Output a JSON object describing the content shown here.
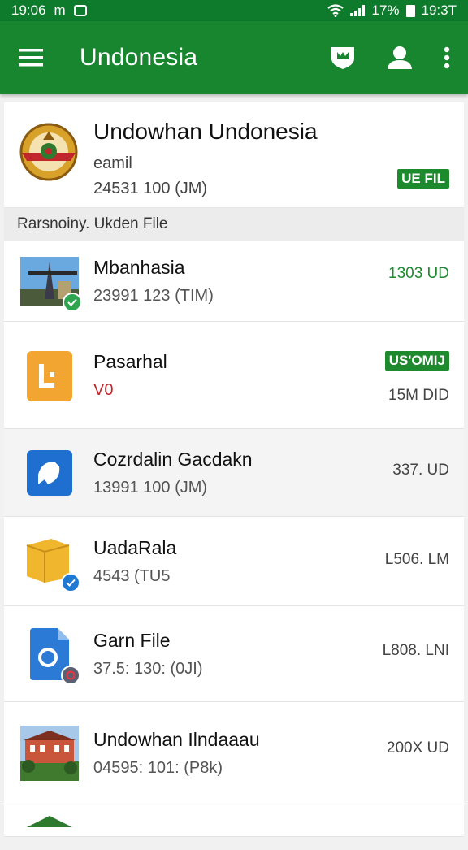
{
  "status_bar": {
    "time": "19:06",
    "carrier": "m",
    "battery": "17%",
    "clock_right": "19:3T"
  },
  "app_bar": {
    "title": "Undonesia",
    "icons": [
      "menu-icon",
      "shield-icon",
      "account-icon",
      "more-vert-icon"
    ]
  },
  "header": {
    "name": "Undowhan Undonesia",
    "subtitle": "eamil",
    "detail": "24531 100 (JM)",
    "badge": "UE FIL"
  },
  "section": {
    "label": "Rarsnoiny. Ukden File"
  },
  "files": [
    {
      "name": "Mbanhasia",
      "meta": "23991 123 (TIM)",
      "size": "1303 UD",
      "size_color": "#1d8a2e",
      "icon": "landmark-photo-icon"
    },
    {
      "name": "Pasarhal",
      "meta": "V0",
      "badge": "US'OMIJ",
      "size": "15M DID",
      "icon": "orange-app-icon"
    },
    {
      "name": "Cozrdalin Gacdakn",
      "meta": "13991 100 (JM)",
      "size": "337. UD",
      "icon": "blue-app-icon"
    },
    {
      "name": "UadaRala",
      "meta": "4543 (TU5",
      "size": "L506. LM",
      "icon": "yellow-box-icon"
    },
    {
      "name": "Garn File",
      "meta": "37.5: 130: (0JI)",
      "size": "L808. LNI",
      "icon": "blue-document-icon"
    },
    {
      "name": "Undowhan Ilndaaau",
      "meta": "04595: 101: (P8k)",
      "size": "200X UD",
      "icon": "building-photo-icon"
    }
  ],
  "colors": {
    "primary": "#17862f",
    "status_bar": "#0d7a2c",
    "accent_green": "#1d8a2e",
    "accent_red": "#c0262b"
  }
}
